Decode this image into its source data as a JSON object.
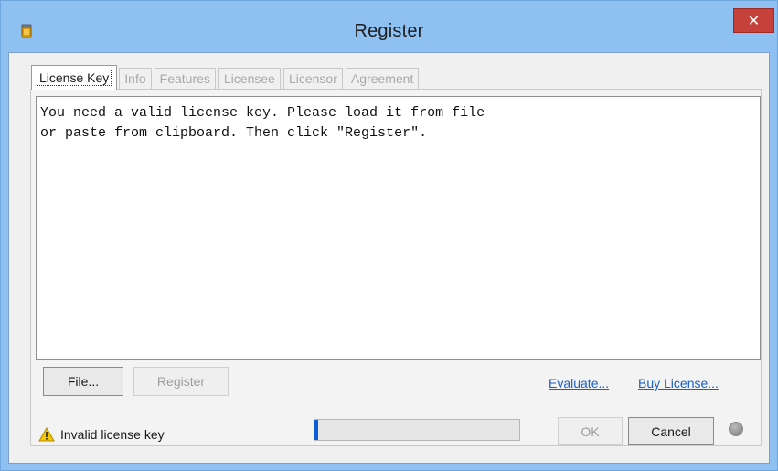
{
  "window": {
    "title": "Register",
    "close_icon": "close-icon",
    "app_icon": "license-jar-icon"
  },
  "tabs": [
    {
      "label": "License Key",
      "active": true
    },
    {
      "label": "Info",
      "active": false
    },
    {
      "label": "Features",
      "active": false
    },
    {
      "label": "Licensee",
      "active": false
    },
    {
      "label": "Licensor",
      "active": false
    },
    {
      "label": "Agreement",
      "active": false
    }
  ],
  "license_text": "You need a valid license key. Please load it from file\nor paste from clipboard. Then click \"Register\".",
  "buttons": {
    "file": "File...",
    "register": "Register",
    "ok": "OK",
    "cancel": "Cancel"
  },
  "links": {
    "evaluate": "Evaluate...",
    "buy_license": "Buy License..."
  },
  "status": {
    "icon": "warning-icon",
    "text": "Invalid license key",
    "progress": 0.01
  },
  "colors": {
    "title_bar": "#8ec1f2",
    "close_button": "#c7413b",
    "link": "#1b5fc4",
    "progress_fill": "#0b5ed7"
  }
}
